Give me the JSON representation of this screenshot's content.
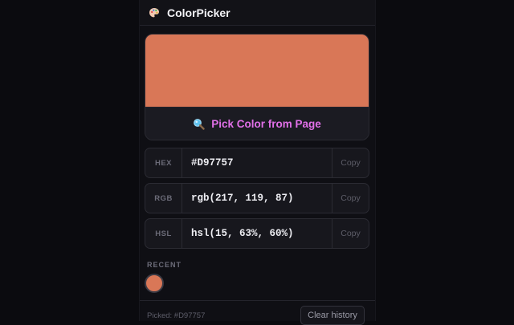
{
  "app": {
    "title": "ColorPicker",
    "icon": "palette-icon"
  },
  "current_color": {
    "hex_color": "#D97757"
  },
  "pick_button": {
    "label": "Pick Color from Page",
    "icon": "magnifier-icon",
    "label_color": "#e170e8"
  },
  "formats": [
    {
      "label": "HEX",
      "value": "#D97757",
      "copy_label": "Copy"
    },
    {
      "label": "RGB",
      "value": "rgb(217, 119, 87)",
      "copy_label": "Copy"
    },
    {
      "label": "HSL",
      "value": "hsl(15, 63%, 60%)",
      "copy_label": "Copy"
    }
  ],
  "recent": {
    "label": "RECENT",
    "swatches": [
      "#D97757"
    ]
  },
  "footer": {
    "picked_text": "Picked: #D97757",
    "clear_label": "Clear history"
  }
}
